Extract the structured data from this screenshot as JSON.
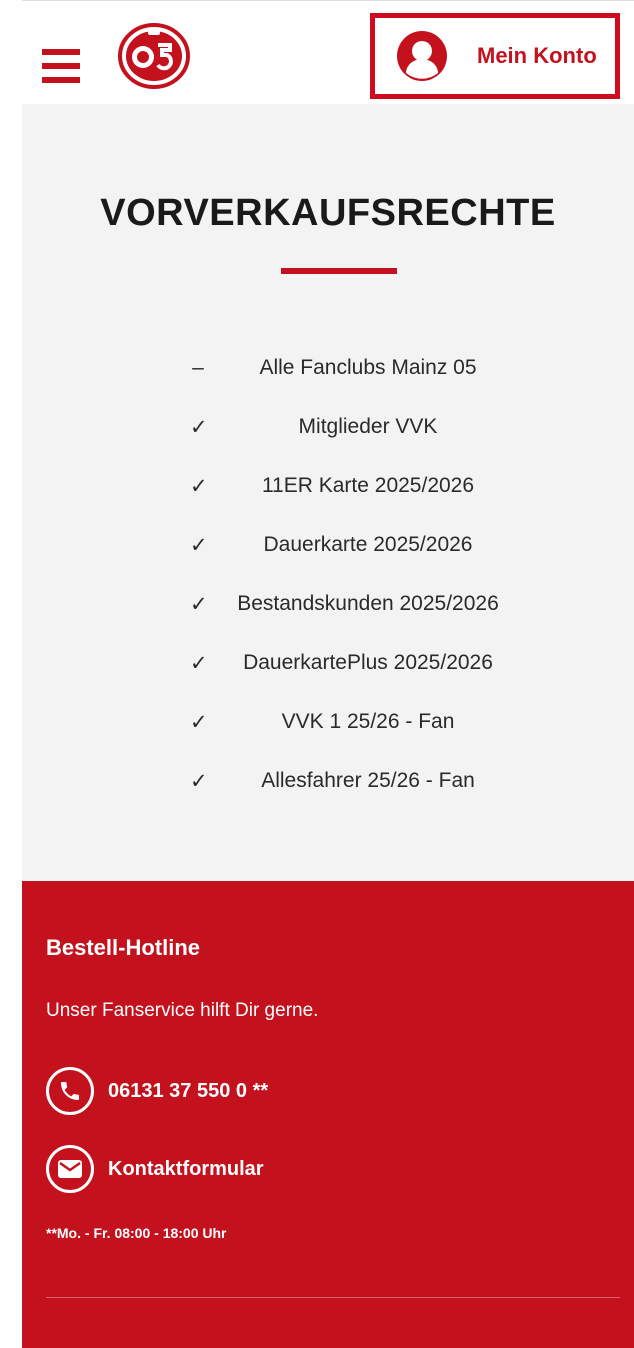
{
  "header": {
    "account_label": "Mein Konto",
    "menu_icon": "hamburger-menu-icon",
    "logo_icon": "mainz-05-logo",
    "account_icon": "user-avatar-icon",
    "brand_color": "#c3121e"
  },
  "main": {
    "title": "VORVERKAUFSRECHTE",
    "rights": [
      {
        "mark": "–",
        "label": "Alle Fanclubs Mainz 05"
      },
      {
        "mark": "✓",
        "label": "Mitglieder VVK"
      },
      {
        "mark": "✓",
        "label": "11ER Karte 2025/2026"
      },
      {
        "mark": "✓",
        "label": "Dauerkarte 2025/2026"
      },
      {
        "mark": "✓",
        "label": "Bestandskunden 2025/2026"
      },
      {
        "mark": "✓",
        "label": "DauerkartePlus 2025/2026"
      },
      {
        "mark": "✓",
        "label": "VVK 1 25/26 - Fan"
      },
      {
        "mark": "✓",
        "label": "Allesfahrer 25/26 - Fan"
      }
    ]
  },
  "footer": {
    "title": "Bestell-Hotline",
    "subtitle": "Unser Fanservice hilft Dir gerne.",
    "phone": "06131 37 550 0 **",
    "contact_form": "Kontaktformular",
    "hours": "**Mo. - Fr. 08:00 - 18:00 Uhr",
    "phone_icon": "phone-icon",
    "mail_icon": "mail-icon"
  }
}
